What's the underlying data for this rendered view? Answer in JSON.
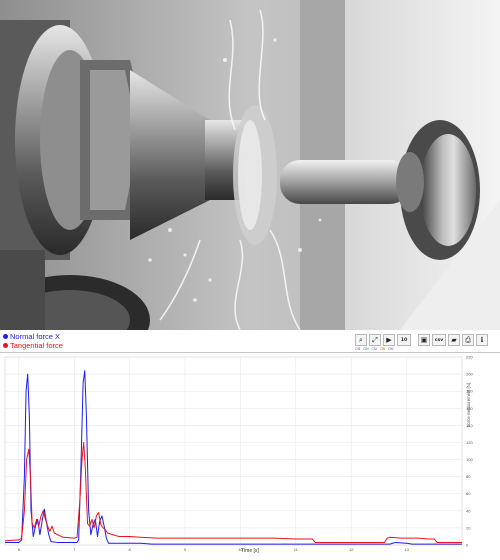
{
  "photo": {
    "description_icon": "machining-photo-icon"
  },
  "legend": {
    "items": [
      {
        "label": "Normal force X",
        "color": "#1c1cf0"
      },
      {
        "label": "Tangential force",
        "color": "#e8141c"
      }
    ]
  },
  "toolbar": {
    "buttons": [
      {
        "name": "zoom-icon",
        "glyph": "⌕"
      },
      {
        "name": "fit-icon",
        "glyph": "⤢"
      },
      {
        "name": "play-icon",
        "glyph": "▶"
      },
      {
        "name": "speed-select",
        "glyph": "10"
      },
      {
        "name": "save-icon",
        "glyph": "▣"
      },
      {
        "name": "csv-button",
        "glyph": "csv"
      },
      {
        "name": "open-folder-icon",
        "glyph": "▰"
      },
      {
        "name": "print-icon",
        "glyph": "⎙"
      },
      {
        "name": "info-icon",
        "glyph": "ℹ"
      }
    ],
    "sub_labels": [
      "ON",
      "ON",
      "CM",
      "ON",
      "ON"
    ]
  },
  "chart_data": {
    "type": "line",
    "xlabel": "Time [s]",
    "ylabel": "Force measurement [N]",
    "ylim": [
      0,
      220
    ],
    "y_ticks": [
      "220",
      "200",
      "180",
      "160",
      "140",
      "120",
      "100",
      "80",
      "60",
      "40",
      "20",
      "0"
    ],
    "x_ticks": [
      "6",
      "7",
      "8",
      "9",
      "10",
      "11",
      "12",
      "13"
    ],
    "xlim": [
      5.75,
      14.0
    ],
    "grid": true,
    "series": [
      {
        "name": "Normal force X",
        "color": "#1c1cf0",
        "points": [
          [
            5.75,
            3
          ],
          [
            6.0,
            3
          ],
          [
            6.05,
            6
          ],
          [
            6.1,
            80
          ],
          [
            6.13,
            180
          ],
          [
            6.16,
            200
          ],
          [
            6.19,
            150
          ],
          [
            6.22,
            40
          ],
          [
            6.26,
            10
          ],
          [
            6.3,
            22
          ],
          [
            6.34,
            30
          ],
          [
            6.38,
            12
          ],
          [
            6.42,
            28
          ],
          [
            6.46,
            42
          ],
          [
            6.5,
            26
          ],
          [
            6.54,
            12
          ],
          [
            6.58,
            4
          ],
          [
            6.7,
            3
          ],
          [
            7.0,
            3
          ],
          [
            7.05,
            3
          ],
          [
            7.08,
            6
          ],
          [
            7.12,
            90
          ],
          [
            7.16,
            190
          ],
          [
            7.19,
            204
          ],
          [
            7.22,
            150
          ],
          [
            7.26,
            40
          ],
          [
            7.3,
            12
          ],
          [
            7.34,
            24
          ],
          [
            7.38,
            30
          ],
          [
            7.42,
            10
          ],
          [
            7.46,
            28
          ],
          [
            7.5,
            34
          ],
          [
            7.54,
            22
          ],
          [
            7.58,
            8
          ],
          [
            7.62,
            2
          ],
          [
            7.8,
            2
          ],
          [
            8.0,
            2
          ],
          [
            8.2,
            2
          ],
          [
            8.4,
            1
          ],
          [
            8.6,
            1
          ],
          [
            9.0,
            1
          ],
          [
            9.4,
            1
          ],
          [
            9.8,
            1
          ],
          [
            10.2,
            1
          ],
          [
            10.6,
            1
          ],
          [
            11.0,
            1
          ],
          [
            11.3,
            1
          ],
          [
            11.6,
            1
          ],
          [
            12.0,
            1
          ],
          [
            12.3,
            1
          ],
          [
            12.6,
            1
          ],
          [
            12.7,
            1
          ],
          [
            12.75,
            2
          ],
          [
            12.8,
            3
          ],
          [
            13.0,
            2
          ],
          [
            13.1,
            1
          ],
          [
            13.4,
            1
          ],
          [
            13.7,
            1
          ],
          [
            14.0,
            1
          ]
        ]
      },
      {
        "name": "Tangential force",
        "color": "#e8141c",
        "points": [
          [
            5.75,
            5
          ],
          [
            6.0,
            6
          ],
          [
            6.05,
            8
          ],
          [
            6.1,
            40
          ],
          [
            6.14,
            100
          ],
          [
            6.18,
            112
          ],
          [
            6.21,
            80
          ],
          [
            6.24,
            25
          ],
          [
            6.28,
            20
          ],
          [
            6.32,
            30
          ],
          [
            6.36,
            22
          ],
          [
            6.4,
            34
          ],
          [
            6.44,
            40
          ],
          [
            6.48,
            30
          ],
          [
            6.52,
            22
          ],
          [
            6.56,
            16
          ],
          [
            6.6,
            22
          ],
          [
            6.64,
            14
          ],
          [
            6.7,
            12
          ],
          [
            6.8,
            9
          ],
          [
            7.0,
            8
          ],
          [
            7.05,
            9
          ],
          [
            7.1,
            50
          ],
          [
            7.14,
            100
          ],
          [
            7.17,
            120
          ],
          [
            7.2,
            90
          ],
          [
            7.24,
            25
          ],
          [
            7.28,
            22
          ],
          [
            7.32,
            30
          ],
          [
            7.36,
            20
          ],
          [
            7.4,
            34
          ],
          [
            7.44,
            38
          ],
          [
            7.48,
            24
          ],
          [
            7.52,
            20
          ],
          [
            7.56,
            18
          ],
          [
            7.6,
            14
          ],
          [
            7.7,
            12
          ],
          [
            7.8,
            10
          ],
          [
            8.0,
            10
          ],
          [
            8.2,
            9
          ],
          [
            8.5,
            8
          ],
          [
            8.8,
            8
          ],
          [
            9.0,
            8
          ],
          [
            9.4,
            8
          ],
          [
            9.8,
            8
          ],
          [
            10.2,
            8
          ],
          [
            10.6,
            8
          ],
          [
            11.0,
            7
          ],
          [
            11.3,
            7
          ],
          [
            11.35,
            3
          ],
          [
            11.6,
            3
          ],
          [
            12.0,
            3
          ],
          [
            12.4,
            3
          ],
          [
            12.6,
            3
          ],
          [
            12.65,
            8
          ],
          [
            12.7,
            9
          ],
          [
            12.9,
            8
          ],
          [
            13.2,
            8
          ],
          [
            13.4,
            7
          ],
          [
            13.5,
            7
          ],
          [
            13.55,
            3
          ],
          [
            13.7,
            3
          ],
          [
            14.0,
            3
          ]
        ]
      }
    ]
  }
}
